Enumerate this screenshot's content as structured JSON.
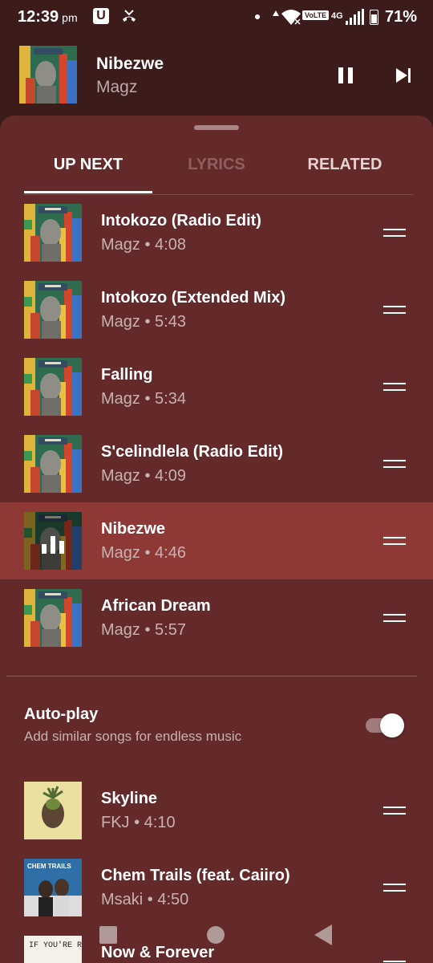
{
  "status_bar": {
    "time": "12:39",
    "ampm": "pm",
    "u_icon_text": "U",
    "volte": "VoLTE",
    "network": "4G",
    "battery": "71%",
    "battery_level": 0.71
  },
  "mini_player": {
    "title": "Nibezwe",
    "artist": "Magz"
  },
  "tabs": [
    "UP NEXT",
    "LYRICS",
    "RELATED"
  ],
  "queue": [
    {
      "title": "Intokozo (Radio Edit)",
      "subtitle": "Magz • 4:08"
    },
    {
      "title": "Intokozo (Extended Mix)",
      "subtitle": "Magz • 5:43"
    },
    {
      "title": "Falling",
      "subtitle": "Magz • 5:34"
    },
    {
      "title": "S'celindlela (Radio Edit)",
      "subtitle": "Magz • 4:09"
    },
    {
      "title": "Nibezwe",
      "subtitle": "Magz • 4:46",
      "playing": true
    },
    {
      "title": "African Dream",
      "subtitle": "Magz • 5:57"
    }
  ],
  "autoplay": {
    "title": "Auto-play",
    "subtitle": "Add similar songs for endless music",
    "enabled": true
  },
  "autoplay_queue": [
    {
      "title": "Skyline",
      "subtitle": "FKJ • 4:10"
    },
    {
      "title": "Chem Trails (feat. Caiiro)",
      "subtitle": "Msaki • 4:50",
      "art_text": "CHEM TRAILS"
    },
    {
      "title": "Now & Forever",
      "subtitle": "",
      "art_text": "IF YOU'RE READING"
    }
  ],
  "colors": {
    "background": "#3b1c1b",
    "sheet": "#632a29",
    "active_row": "#8f3937"
  }
}
